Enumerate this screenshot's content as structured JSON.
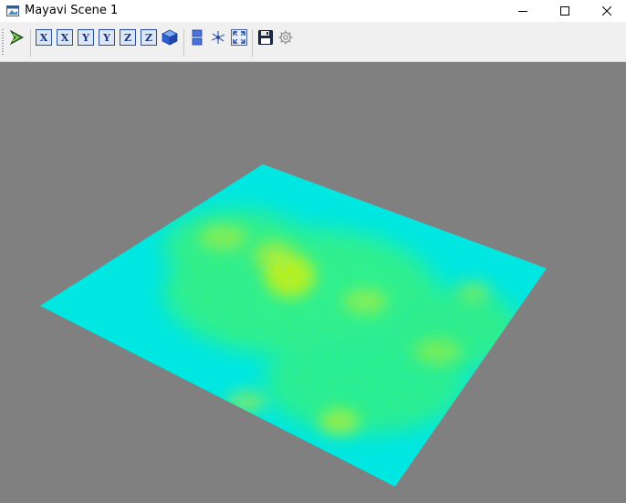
{
  "window": {
    "title": "Mayavi Scene 1",
    "icon": "app-window-icon",
    "controls": [
      "minimize-icon",
      "maximize-icon",
      "close-icon"
    ]
  },
  "toolbar": {
    "buttons": [
      {
        "name": "mayavi-pipeline-button",
        "icon": "mayavi-logo-icon"
      },
      {
        "name": "view-x-positive-button",
        "label": "X",
        "icon": "axis-x-icon"
      },
      {
        "name": "view-x-negative-button",
        "label": "X",
        "icon": "axis-x-icon"
      },
      {
        "name": "view-y-positive-button",
        "label": "Y",
        "icon": "axis-y-icon"
      },
      {
        "name": "view-y-negative-button",
        "label": "Y",
        "icon": "axis-y-icon"
      },
      {
        "name": "view-z-positive-button",
        "label": "Z",
        "icon": "axis-z-icon"
      },
      {
        "name": "view-z-negative-button",
        "label": "Z",
        "icon": "axis-z-icon"
      },
      {
        "name": "isometric-view-button",
        "icon": "cube-icon"
      },
      {
        "name": "parallel-projection-button",
        "icon": "projection-icon"
      },
      {
        "name": "axes-indicator-button",
        "icon": "axes-icon"
      },
      {
        "name": "full-screen-button",
        "icon": "fullscreen-icon"
      },
      {
        "name": "save-button",
        "icon": "save-icon"
      },
      {
        "name": "configure-scene-button",
        "icon": "gear-icon"
      }
    ]
  },
  "scene": {
    "background": "#808080",
    "colormap": "surface colored cyan through green to yellow",
    "colors": {
      "low": "#00e6e6",
      "mid": "#3cf06e",
      "high": "#e6f000"
    }
  }
}
